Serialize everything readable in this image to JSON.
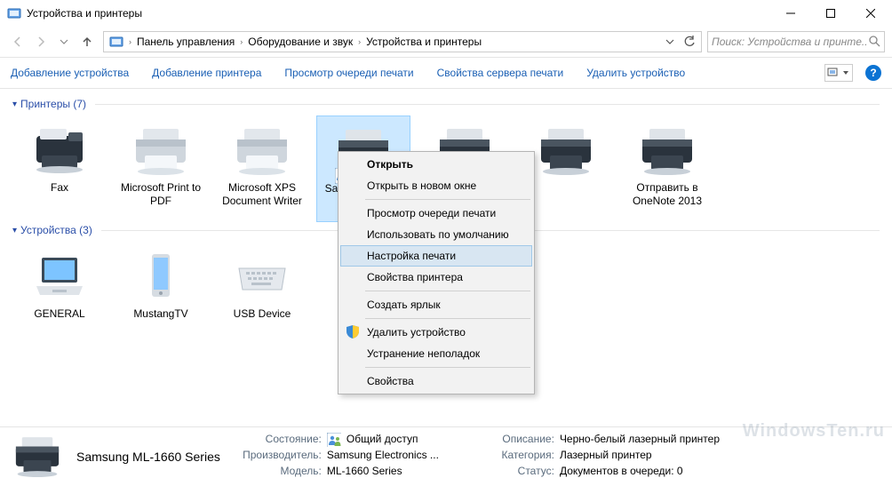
{
  "window": {
    "title": "Устройства и принтеры"
  },
  "breadcrumb": {
    "a": "Панель управления",
    "b": "Оборудование и звук",
    "c": "Устройства и принтеры"
  },
  "search": {
    "placeholder": "Поиск: Устройства и принте..."
  },
  "toolbar": {
    "add_device": "Добавление устройства",
    "add_printer": "Добавление принтера",
    "view_queue": "Просмотр очереди печати",
    "server_props": "Свойства сервера печати",
    "remove": "Удалить устройство"
  },
  "groups": {
    "printers": {
      "label": "Принтеры (7)"
    },
    "devices": {
      "label": "Устройства (3)"
    }
  },
  "printers": [
    {
      "label": "Fax",
      "kind": "fax"
    },
    {
      "label": "Microsoft Print to PDF",
      "kind": "printer"
    },
    {
      "label": "Microsoft XPS Document Writer",
      "kind": "printer"
    },
    {
      "label": "Samsung ML-…",
      "kind": "printer-dark",
      "selected": true,
      "shared": true
    },
    {
      "label": "",
      "kind": "printer-dark"
    },
    {
      "label": "",
      "kind": "printer-dark"
    },
    {
      "label": "Отправить в OneNote 2013",
      "kind": "printer-dark"
    }
  ],
  "devices": [
    {
      "label": "GENERAL",
      "kind": "laptop"
    },
    {
      "label": "MustangTV",
      "kind": "phone"
    },
    {
      "label": "USB Device",
      "kind": "keyboard"
    }
  ],
  "context_menu": {
    "open": "Открыть",
    "open_new": "Открыть в новом окне",
    "queue": "Просмотр очереди печати",
    "default": "Использовать по умолчанию",
    "pref": "Настройка печати",
    "props_printer": "Свойства принтера",
    "shortcut": "Создать ярлык",
    "remove": "Удалить устройство",
    "troubleshoot": "Устранение неполадок",
    "props": "Свойства"
  },
  "details": {
    "name": "Samsung ML-1660 Series",
    "rows": {
      "state_k": "Состояние:",
      "state_v": "Общий доступ",
      "mfr_k": "Производитель:",
      "mfr_v": "Samsung Electronics ...",
      "model_k": "Модель:",
      "model_v": "ML-1660 Series",
      "desc_k": "Описание:",
      "desc_v": "Черно-белый лазерный принтер",
      "cat_k": "Категория:",
      "cat_v": "Лазерный принтер",
      "queue_k": "Статус:",
      "queue_v": "Документов в очереди: 0"
    }
  },
  "watermark": "WindowsTen.ru"
}
